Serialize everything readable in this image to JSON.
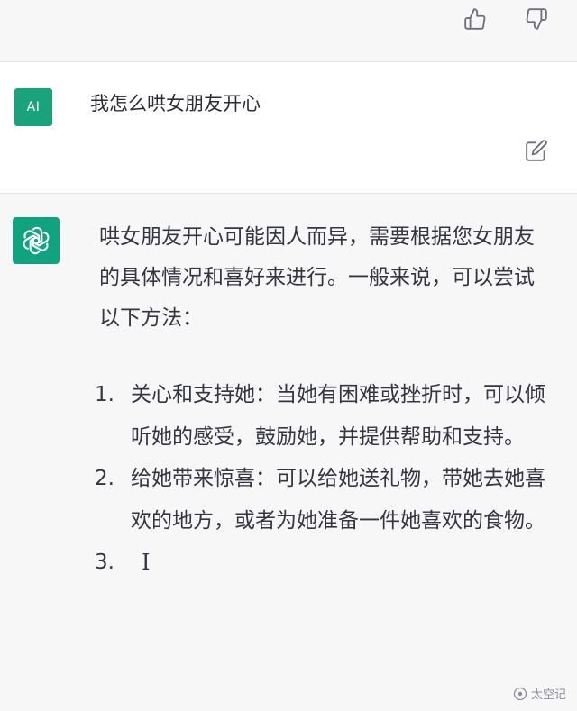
{
  "feedback": {
    "thumbs_up_icon": "thumbs-up",
    "thumbs_down_icon": "thumbs-down"
  },
  "user_message": {
    "avatar_label": "AI",
    "text": "我怎么哄女朋友开心",
    "edit_icon": "edit"
  },
  "assistant_message": {
    "intro": "哄女朋友开心可能因人而异，需要根据您女朋友的具体情况和喜好来进行。一般来说，可以尝试以下方法：",
    "items": [
      {
        "num": "1.",
        "text": "关心和支持她：当她有困难或挫折时，可以倾听她的感受，鼓励她，并提供帮助和支持。"
      },
      {
        "num": "2.",
        "text": "给她带来惊喜：可以给她送礼物，带她去她喜欢的地方，或者为她准备一件她喜欢的食物。"
      },
      {
        "num": "3.",
        "text": ""
      }
    ],
    "cursor_glyph": "I"
  },
  "watermark": "太空记",
  "colors": {
    "accent_green": "#10a37f",
    "user_avatar_bg": "#19a37c",
    "bg_light": "#f7f7f8"
  }
}
